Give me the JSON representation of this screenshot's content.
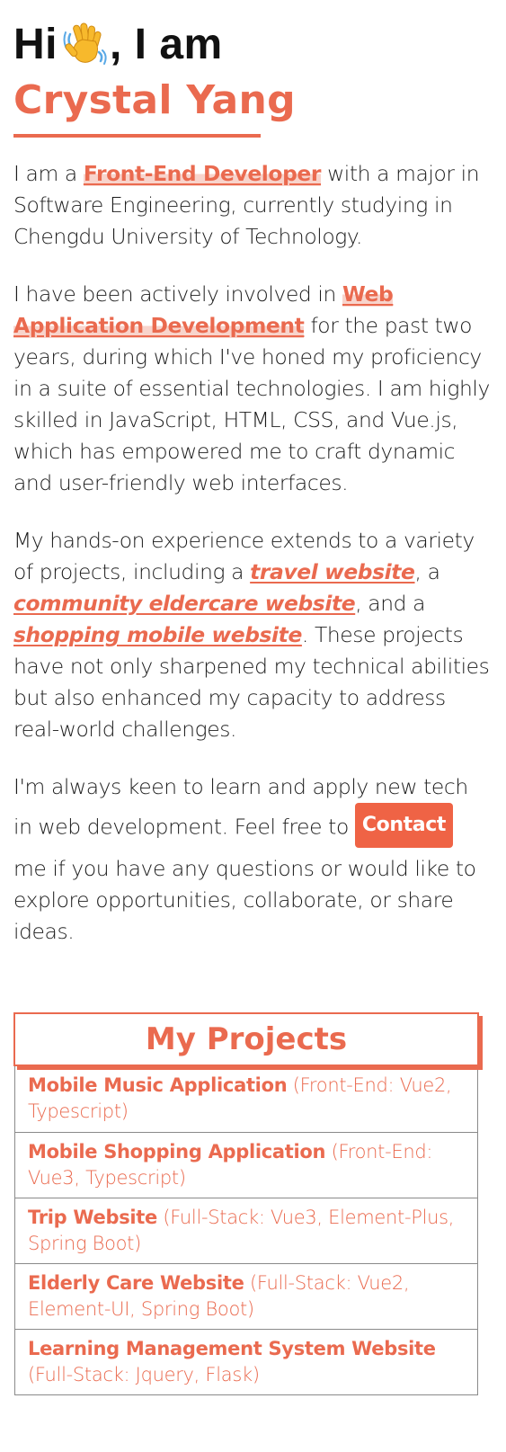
{
  "hero": {
    "greeting_pre": "Hi",
    "greeting_post": ", I am",
    "wave_icon": "waving-hand-emoji",
    "name": "Crystal Yang"
  },
  "about": {
    "p1": {
      "t1": "I am a ",
      "hl": "Front-End Developer",
      "t2": " with a major in Software Engineering, currently studying in Chengdu University of Technology."
    },
    "p2": {
      "t1": "I have been actively involved in ",
      "hl": "Web Application Development",
      "t2": " for the past two years, during which I've honed my proficiency in a suite of essential technologies. I am highly skilled in JavaScript, HTML, CSS, and Vue.js, which has empowered me to craft dynamic and user-friendly web interfaces."
    },
    "p3": {
      "t1": "My hands-on experience extends to a variety of projects, including a ",
      "link1": "travel website",
      "t2": ", a ",
      "link2": "community eldercare website",
      "t3": ", and a ",
      "link3": "shopping mobile website",
      "t4": ". These projects have not only sharpened my technical abilities but also enhanced my capacity to address real-world challenges."
    },
    "p4": {
      "t1": "I'm always keen to learn and apply new tech in web development. Feel free to ",
      "contact": "Contact",
      "t2": " me if you have any questions or would like to explore opportunities, collaborate, or share ideas."
    }
  },
  "projects": {
    "title": "My Projects",
    "items": [
      {
        "name": "Mobile Music Application",
        "tech": "(Front-End: Vue2, Typescript)"
      },
      {
        "name": "Mobile Shopping Application",
        "tech": "(Front-End: Vue3, Typescript)"
      },
      {
        "name": "Trip Website",
        "tech": "(Full-Stack: Vue3, Element-Plus, Spring Boot)"
      },
      {
        "name": "Elderly Care Website",
        "tech": "(Full-Stack: Vue2, Element-UI, Spring Boot)"
      },
      {
        "name": "Learning Management System Website",
        "tech": "(Full-Stack: Jquery, Flask)"
      }
    ]
  },
  "colors": {
    "accent": "#ea6a4f",
    "button": "#ef6345",
    "highlight_bg": "#f8d4cc",
    "text": "#1c1c1c"
  }
}
